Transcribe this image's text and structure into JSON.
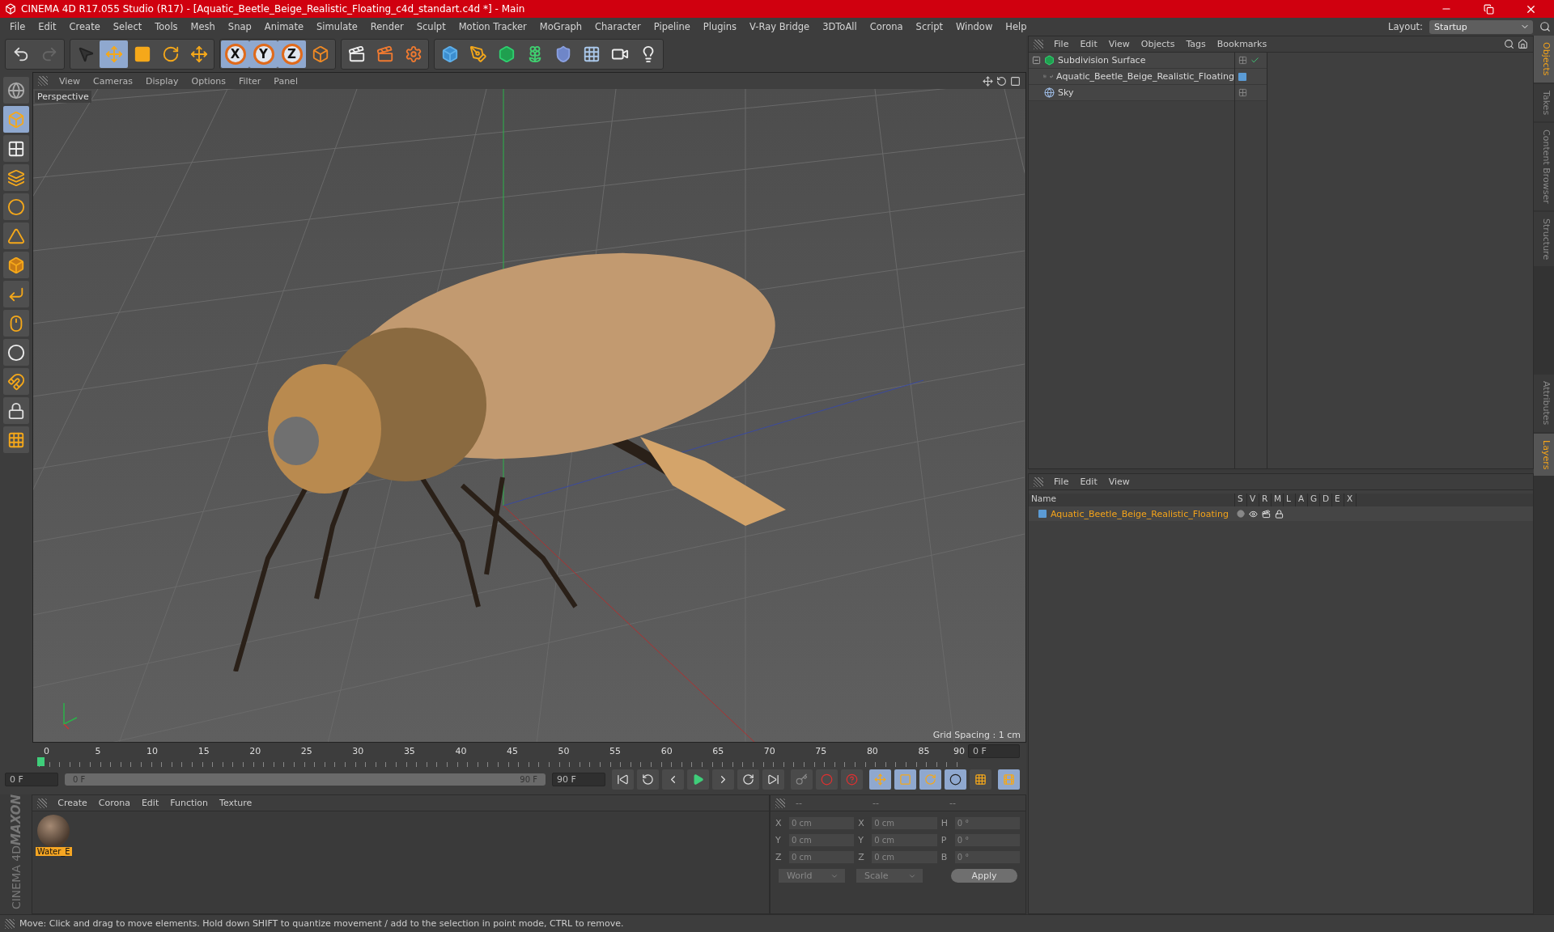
{
  "title_bar": {
    "title": "CINEMA 4D R17.055 Studio (R17) - [Aquatic_Beetle_Beige_Realistic_Floating_c4d_standart.c4d *] - Main"
  },
  "menu_bar": {
    "items": [
      "File",
      "Edit",
      "Create",
      "Select",
      "Tools",
      "Mesh",
      "Snap",
      "Animate",
      "Simulate",
      "Render",
      "Sculpt",
      "Motion Tracker",
      "MoGraph",
      "Character",
      "Pipeline",
      "Plugins",
      "V-Ray Bridge",
      "3DToAll",
      "Corona",
      "Script",
      "Window",
      "Help"
    ],
    "layout_label": "Layout:",
    "layout_value": "Startup"
  },
  "toolbar": {
    "groups": [
      {
        "tools": [
          {
            "kind": "undo",
            "selected": false
          },
          {
            "kind": "redo",
            "selected": false
          }
        ]
      },
      {
        "tools": [
          {
            "kind": "select",
            "selected": false
          },
          {
            "kind": "move",
            "selected": true
          },
          {
            "kind": "scale",
            "selected": false
          },
          {
            "kind": "rotate",
            "selected": false
          },
          {
            "kind": "move",
            "selected": false
          }
        ]
      },
      {
        "tools": [
          {
            "kind": "axis",
            "label": "X",
            "selected": true
          },
          {
            "kind": "axis",
            "label": "Y",
            "selected": true
          },
          {
            "kind": "axis",
            "label": "Z",
            "selected": true
          },
          {
            "kind": "coords",
            "selected": false
          }
        ]
      },
      {
        "tools": [
          {
            "kind": "render-view",
            "selected": false
          },
          {
            "kind": "render",
            "selected": false
          },
          {
            "kind": "render-settings",
            "selected": false
          }
        ]
      },
      {
        "tools": [
          {
            "kind": "cube",
            "selected": false
          },
          {
            "kind": "pen",
            "selected": false
          },
          {
            "kind": "subdivision",
            "selected": false
          },
          {
            "kind": "cloner",
            "selected": false
          },
          {
            "kind": "deformer",
            "selected": false
          },
          {
            "kind": "floor",
            "selected": false
          },
          {
            "kind": "camera",
            "selected": false
          },
          {
            "kind": "light",
            "selected": false
          }
        ]
      }
    ]
  },
  "left_toolbar": {
    "tools": [
      {
        "kind": "editable",
        "selected": false
      },
      {
        "kind": "model",
        "selected": true
      },
      {
        "kind": "texture",
        "selected": false
      },
      {
        "kind": "workplane",
        "selected": false
      },
      {
        "kind": "points",
        "selected": false
      },
      {
        "kind": "edges",
        "selected": false
      },
      {
        "kind": "polygons",
        "selected": false
      },
      {
        "kind": "axis",
        "selected": false
      },
      {
        "kind": "tweak",
        "selected": false
      },
      {
        "kind": "snap",
        "selected": false
      },
      {
        "kind": "magnet",
        "selected": false
      },
      {
        "kind": "grid-lock",
        "selected": false
      },
      {
        "kind": "grid-snap",
        "selected": false
      }
    ]
  },
  "viewport": {
    "menu": [
      "View",
      "Cameras",
      "Display",
      "Options",
      "Filter",
      "Panel"
    ],
    "camera": "Perspective",
    "grid_spacing": "Grid Spacing : 1 cm"
  },
  "timeline": {
    "ticks": [
      "0",
      "5",
      "10",
      "15",
      "20",
      "25",
      "30",
      "35",
      "40",
      "45",
      "50",
      "55",
      "60",
      "65",
      "70",
      "75",
      "80",
      "85",
      "90"
    ],
    "level": 0,
    "current_frame": "0 F",
    "start": "0 F",
    "range": {
      "start": "0 F",
      "end": "90 F",
      "level": 1
    },
    "end": "90 F"
  },
  "material_manager": {
    "menu": [
      "Create",
      "Corona",
      "Edit",
      "Function",
      "Texture"
    ],
    "materials": [
      {
        "name": "Water_E",
        "selected": true
      }
    ]
  },
  "coordinates": {
    "headers": [
      "--",
      "--",
      "--"
    ],
    "rows": [
      {
        "axis": "X",
        "position": "0 cm",
        "size_axis": "X",
        "size": "0 cm",
        "rot_axis": "H",
        "rotation": "0 °"
      },
      {
        "axis": "Y",
        "position": "0 cm",
        "size_axis": "Y",
        "size": "0 cm",
        "rot_axis": "P",
        "rotation": "0 °"
      },
      {
        "axis": "Z",
        "position": "0 cm",
        "size_axis": "Z",
        "size": "0 cm",
        "rot_axis": "B",
        "rotation": "0 °"
      }
    ],
    "mode": "World",
    "size_mode": "Scale",
    "apply": "Apply"
  },
  "brand": {
    "company": "MAXON",
    "product": "CINEMA 4D"
  },
  "object_manager": {
    "menu": [
      "File",
      "Edit",
      "View",
      "Objects",
      "Tags",
      "Bookmarks"
    ],
    "tree": [
      {
        "name": "Subdivision Surface",
        "kind": "subdivision",
        "expanded": true,
        "children": [
          {
            "name": "Aquatic_Beetle_Beige_Realistic_Floating",
            "kind": "null",
            "expanded": false,
            "color": "#5b9bd5"
          }
        ]
      },
      {
        "name": "Sky",
        "kind": "sky"
      }
    ]
  },
  "layer_manager": {
    "menu": [
      "File",
      "Edit",
      "View"
    ],
    "columns": [
      "Name",
      "S",
      "V",
      "R",
      "M",
      "L",
      "A",
      "G",
      "D",
      "E",
      "X"
    ],
    "rows": [
      {
        "name": "Aquatic_Beetle_Beige_Realistic_Floating",
        "color": "#5b9bd5"
      }
    ]
  },
  "side_tabs": {
    "top": [
      {
        "label": "Objects",
        "selected": true
      },
      {
        "label": "Takes",
        "selected": false
      },
      {
        "label": "Content Browser",
        "selected": false
      },
      {
        "label": "Structure",
        "selected": false
      }
    ],
    "bottom": [
      {
        "label": "Attributes",
        "selected": false
      },
      {
        "label": "Layers",
        "selected": true
      }
    ]
  },
  "status_bar": {
    "text": "Move: Click and drag to move elements. Hold down SHIFT to quantize movement / add to the selection in point mode, CTRL to remove."
  }
}
